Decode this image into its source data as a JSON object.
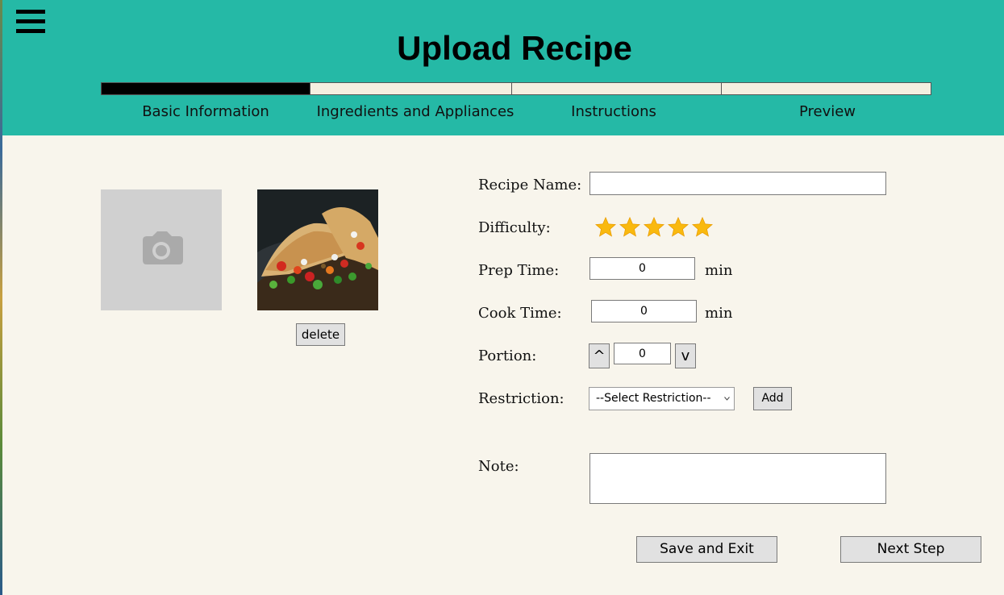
{
  "app": {
    "title": "Upload Recipe"
  },
  "steps": [
    {
      "label": "Basic Information",
      "active": true
    },
    {
      "label": "Ingredients and Appliances",
      "active": false
    },
    {
      "label": "Instructions",
      "active": false
    },
    {
      "label": "Preview",
      "active": false
    }
  ],
  "photos": {
    "delete_label": "delete"
  },
  "form": {
    "recipe_name": {
      "label": "Recipe Name:",
      "value": ""
    },
    "difficulty": {
      "label": "Difficulty:",
      "rating": 5,
      "max": 5
    },
    "prep_time": {
      "label": "Prep Time:",
      "value": "0",
      "unit": "min"
    },
    "cook_time": {
      "label": "Cook Time:",
      "value": "0",
      "unit": "min"
    },
    "portion": {
      "label": "Portion:",
      "value": "0",
      "up_label": "^",
      "down_label": "v"
    },
    "restriction": {
      "label": "Restriction:",
      "selected": "--Select Restriction--",
      "add_label": "Add"
    },
    "note": {
      "label": "Note:",
      "value": ""
    }
  },
  "footer": {
    "save_exit_label": "Save and Exit",
    "next_step_label": "Next Step"
  },
  "colors": {
    "header": "#25b9a6",
    "background": "#f8f5ec",
    "star": "#f9b90f",
    "progress_active": "#000000",
    "progress_inactive": "#f4efe0"
  }
}
